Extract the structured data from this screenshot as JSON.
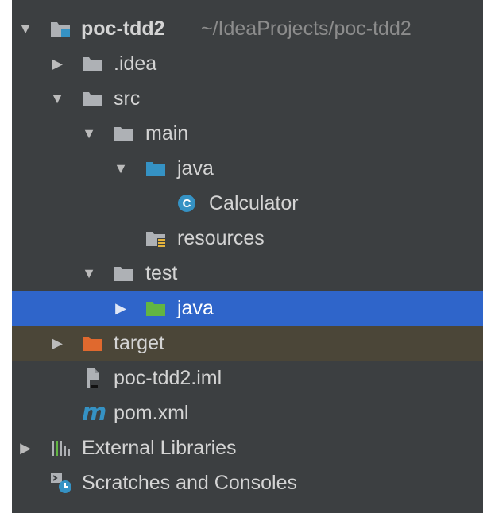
{
  "tree": {
    "root_name": "poc-tdd2",
    "root_path": "~/IdeaProjects/poc-tdd2",
    "idea_label": ".idea",
    "src_label": "src",
    "main_label": "main",
    "main_java_label": "java",
    "calculator_label": "Calculator",
    "resources_label": "resources",
    "test_label": "test",
    "test_java_label": "java",
    "target_label": "target",
    "iml_label": "poc-tdd2.iml",
    "pom_label": "pom.xml",
    "external_libraries_label": "External Libraries",
    "scratches_label": "Scratches and Consoles",
    "class_icon_letter": "C",
    "maven_icon_letter": "m"
  },
  "colors": {
    "panel_bg": "#3c3f41",
    "selection": "#2f65ca",
    "excluded_row": "#4b4638",
    "folder_gray": "#aeb1b5",
    "source_folder_blue": "#3592c4",
    "test_folder_green": "#62b543",
    "excluded_folder_orange": "#e0692e"
  }
}
